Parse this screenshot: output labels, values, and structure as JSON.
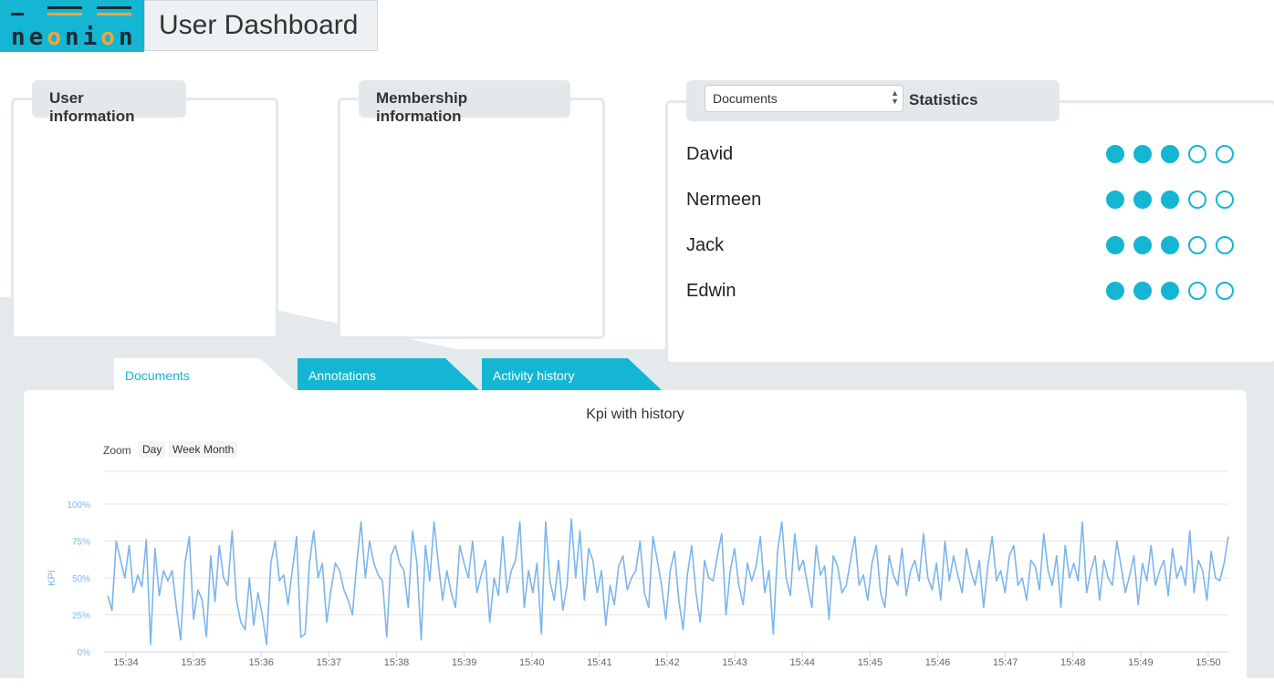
{
  "header": {
    "logo_text": [
      "n",
      "e",
      "o",
      "n",
      "i",
      "o",
      "n"
    ],
    "title": "User Dashboard"
  },
  "panels": {
    "user_info": "User information",
    "membership": "Membership information",
    "statistics": "Statistics",
    "stat_select": "Documents"
  },
  "statistics": [
    {
      "name": "David",
      "rating": 3,
      "max": 5
    },
    {
      "name": "Nermeen",
      "rating": 3,
      "max": 5
    },
    {
      "name": "Jack",
      "rating": 3,
      "max": 5
    },
    {
      "name": "Edwin",
      "rating": 3,
      "max": 5
    }
  ],
  "tabs": [
    {
      "label": "Documents",
      "active": true
    },
    {
      "label": "Annotations",
      "active": false
    },
    {
      "label": "Activity history",
      "active": false
    }
  ],
  "colors": {
    "accent": "#14b6d3",
    "orange": "#f2a33a",
    "line": "#7cb5ec"
  },
  "zoom": {
    "label": "Zoom",
    "buttons": [
      "Day",
      "Week",
      "Month"
    ]
  },
  "chart_data": {
    "type": "line",
    "title": "Kpi with history",
    "ylabel": "KPI",
    "ylim": [
      0,
      100
    ],
    "yticks": [
      "0%",
      "25%",
      "50%",
      "75%",
      "100%"
    ],
    "xticks": [
      "15:34",
      "15:35",
      "15:36",
      "15:37",
      "15:38",
      "15:39",
      "15:40",
      "15:41",
      "15:42",
      "15:43",
      "15:44",
      "15:45",
      "15:46",
      "15:47",
      "15:48",
      "15:49",
      "15:50"
    ],
    "series": [
      {
        "values": [
          38,
          28,
          75,
          62,
          50,
          72,
          40,
          52,
          44,
          76,
          5,
          70,
          38,
          55,
          48,
          55,
          30,
          8,
          60,
          78,
          22,
          42,
          35,
          10,
          65,
          34,
          72,
          50,
          45,
          82,
          35,
          20,
          15,
          50,
          18,
          40,
          25,
          5,
          60,
          75,
          48,
          52,
          32,
          55,
          78,
          10,
          12,
          60,
          82,
          50,
          60,
          20,
          42,
          60,
          55,
          42,
          35,
          25,
          60,
          88,
          50,
          75,
          60,
          52,
          48,
          10,
          65,
          72,
          60,
          55,
          30,
          82,
          60,
          8,
          72,
          48,
          88,
          60,
          35,
          55,
          40,
          30,
          72,
          60,
          50,
          75,
          40,
          52,
          62,
          20,
          50,
          38,
          78,
          40,
          55,
          62,
          88,
          30,
          55,
          40,
          60,
          12,
          88,
          48,
          35,
          62,
          28,
          45,
          90,
          50,
          82,
          35,
          70,
          62,
          40,
          55,
          18,
          45,
          32,
          58,
          65,
          42,
          50,
          55,
          75,
          40,
          30,
          78,
          62,
          45,
          22,
          55,
          68,
          35,
          15,
          52,
          72,
          40,
          20,
          62,
          50,
          48,
          65,
          80,
          25,
          55,
          70,
          45,
          32,
          60,
          48,
          58,
          78,
          40,
          55,
          12,
          68,
          88,
          50,
          38,
          80,
          55,
          62,
          45,
          30,
          72,
          52,
          58,
          22,
          65,
          58,
          40,
          45,
          62,
          78,
          45,
          52,
          35,
          60,
          72,
          40,
          30,
          65,
          52,
          45,
          70,
          38,
          55,
          62,
          48,
          80,
          50,
          42,
          60,
          35,
          75,
          48,
          65,
          52,
          40,
          70,
          55,
          45,
          62,
          30,
          58,
          78,
          48,
          55,
          40,
          65,
          72,
          45,
          50,
          35,
          62,
          58,
          42,
          80,
          55,
          45,
          65,
          30,
          72,
          50,
          60,
          48,
          88,
          40,
          55,
          65,
          35,
          62,
          50,
          45,
          75,
          58,
          40,
          52,
          65,
          32,
          60,
          48,
          72,
          45,
          55,
          62,
          38,
          70,
          50,
          58,
          45,
          82,
          40,
          62,
          55,
          35,
          68,
          50,
          48,
          60,
          78
        ],
        "color": "#7cb5ec"
      }
    ]
  }
}
